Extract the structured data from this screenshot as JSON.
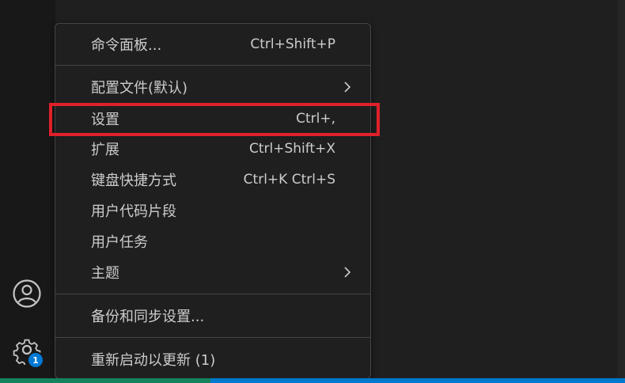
{
  "activity_bar": {
    "account_icon": "account-icon",
    "manage_icon": "gear-icon",
    "manage_badge": "1"
  },
  "menu": {
    "items": [
      {
        "label": "命令面板...",
        "keys": "Ctrl+Shift+P"
      },
      {
        "label": "配置文件(默认)",
        "submenu": true
      },
      {
        "label": "设置",
        "keys": "Ctrl+,"
      },
      {
        "label": "扩展",
        "keys": "Ctrl+Shift+X"
      },
      {
        "label": "键盘快捷方式",
        "keys": "Ctrl+K Ctrl+S"
      },
      {
        "label": "用户代码片段"
      },
      {
        "label": "用户任务"
      },
      {
        "label": "主题",
        "submenu": true
      },
      {
        "label": "备份和同步设置..."
      },
      {
        "label": "重新启动以更新 (1)"
      }
    ]
  },
  "colors": {
    "menu_bg": "#1f1f1f",
    "menu_border": "#454545",
    "text": "#cccccc",
    "badge": "#0078d4",
    "highlight": "#e0202a",
    "status_bar": "#007acc"
  }
}
